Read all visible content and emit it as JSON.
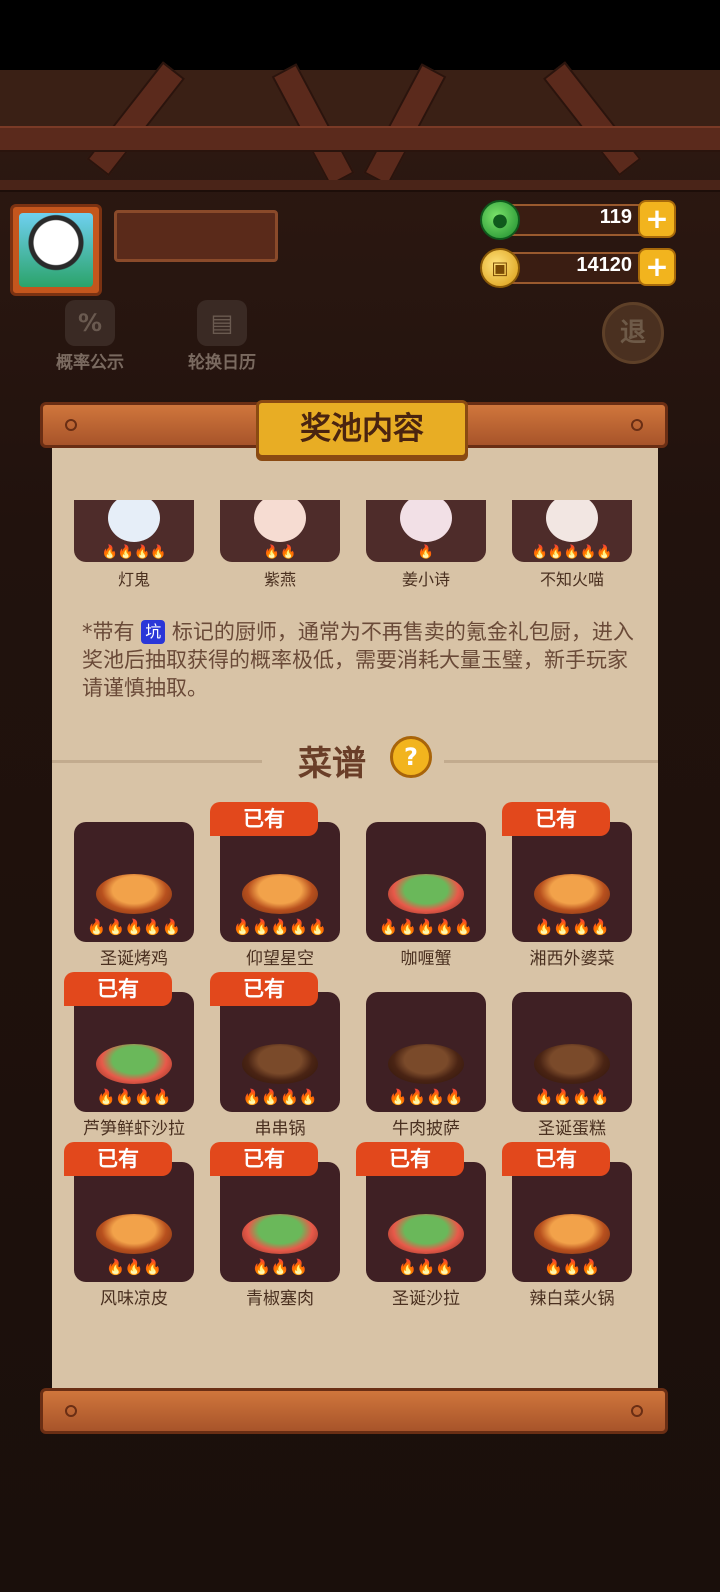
{
  "player": {
    "gems": "119",
    "coins": "14120"
  },
  "side_buttons": {
    "probability": "概率公示",
    "calendar": "轮换日历",
    "exit": "退"
  },
  "panel": {
    "title": "奖池内容",
    "chefs": [
      {
        "name": "灯鬼",
        "flames": "🔥🔥🔥🔥"
      },
      {
        "name": "紫燕",
        "flames": "🔥🔥"
      },
      {
        "name": "姜小诗",
        "flames": "🔥"
      },
      {
        "name": "不知火喵",
        "flames": "🔥🔥🔥🔥🔥"
      }
    ],
    "note_prefix": "*带有",
    "note_tag": "坑",
    "note_text": "标记的厨师，通常为不再售卖的氪金礼包厨，进入奖池后抽取获得的概率极低，需要消耗大量玉璧，新手玩家请谨慎抽取。",
    "recipes_title": "菜谱",
    "help_glyph": "?",
    "owned_label": "已有",
    "recipes": [
      {
        "name": "圣诞烤鸡",
        "owned": false,
        "flames": "🔥🔥🔥🔥🔥"
      },
      {
        "name": "仰望星空",
        "owned": true,
        "flames": "🔥🔥🔥🔥🔥"
      },
      {
        "name": "咖喱蟹",
        "owned": false,
        "flames": "🔥🔥🔥🔥🔥"
      },
      {
        "name": "湘西外婆菜",
        "owned": true,
        "flames": "🔥🔥🔥🔥"
      },
      {
        "name": "芦笋鲜虾沙拉",
        "owned": true,
        "flames": "🔥🔥🔥🔥"
      },
      {
        "name": "串串锅",
        "owned": true,
        "flames": "🔥🔥🔥🔥"
      },
      {
        "name": "牛肉披萨",
        "owned": false,
        "flames": "🔥🔥🔥🔥"
      },
      {
        "name": "圣诞蛋糕",
        "owned": false,
        "flames": "🔥🔥🔥🔥"
      },
      {
        "name": "风味凉皮",
        "owned": true,
        "flames": "🔥🔥🔥"
      },
      {
        "name": "青椒塞肉",
        "owned": true,
        "flames": "🔥🔥🔥"
      },
      {
        "name": "圣诞沙拉",
        "owned": true,
        "flames": "🔥🔥🔥"
      },
      {
        "name": "辣白菜火锅",
        "owned": true,
        "flames": "🔥🔥🔥"
      }
    ]
  }
}
